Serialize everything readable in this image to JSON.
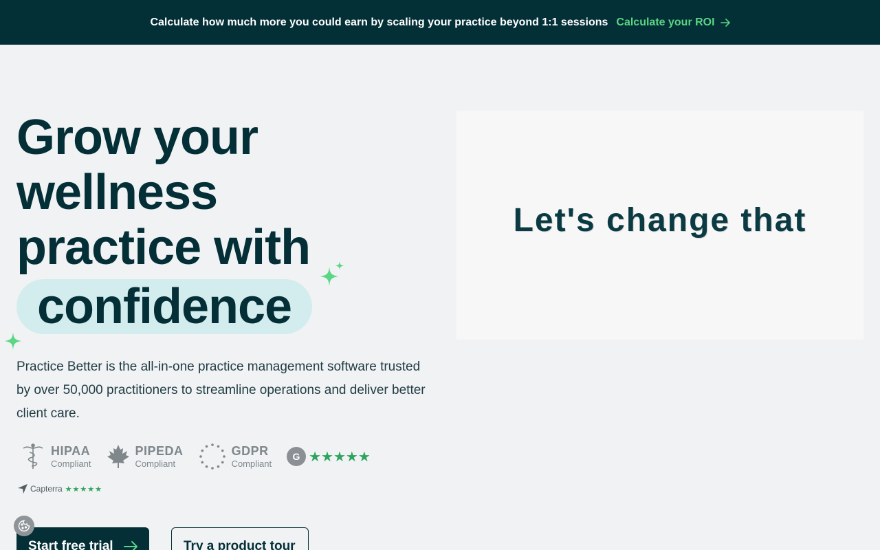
{
  "banner": {
    "text": "Calculate how much more you could earn by scaling your practice beyond 1:1 sessions",
    "link_label": "Calculate your ROI"
  },
  "hero": {
    "title_line_1": "Grow your",
    "title_line_2": "wellness",
    "title_line_3": "practice with",
    "title_highlight": "confidence",
    "description": "Practice Better is the all-in-one practice management software trusted by over 50,000 practitioners to streamline operations and deliver better client care."
  },
  "badges": [
    {
      "name": "HIPAA",
      "sub": "Compliant",
      "icon": "caduceus-icon"
    },
    {
      "name": "PIPEDA",
      "sub": "Compliant",
      "icon": "maple-leaf-icon"
    },
    {
      "name": "GDPR",
      "sub": "Compliant",
      "icon": "eu-stars-icon"
    }
  ],
  "g2": {
    "stars": "★★★★★",
    "rating": 5
  },
  "capterra": {
    "label": "Capterra",
    "stars": "★★★★★",
    "rating": 5
  },
  "buttons": {
    "primary": "Start free trial",
    "secondary": "Try a product tour"
  },
  "video": {
    "text": "Let's change that"
  },
  "colors": {
    "banner_bg": "#032f36",
    "accent_green": "#5bd684",
    "primary_dark": "#042f37",
    "highlight_pill": "#d3eced",
    "page_bg": "#f0f2f4"
  }
}
